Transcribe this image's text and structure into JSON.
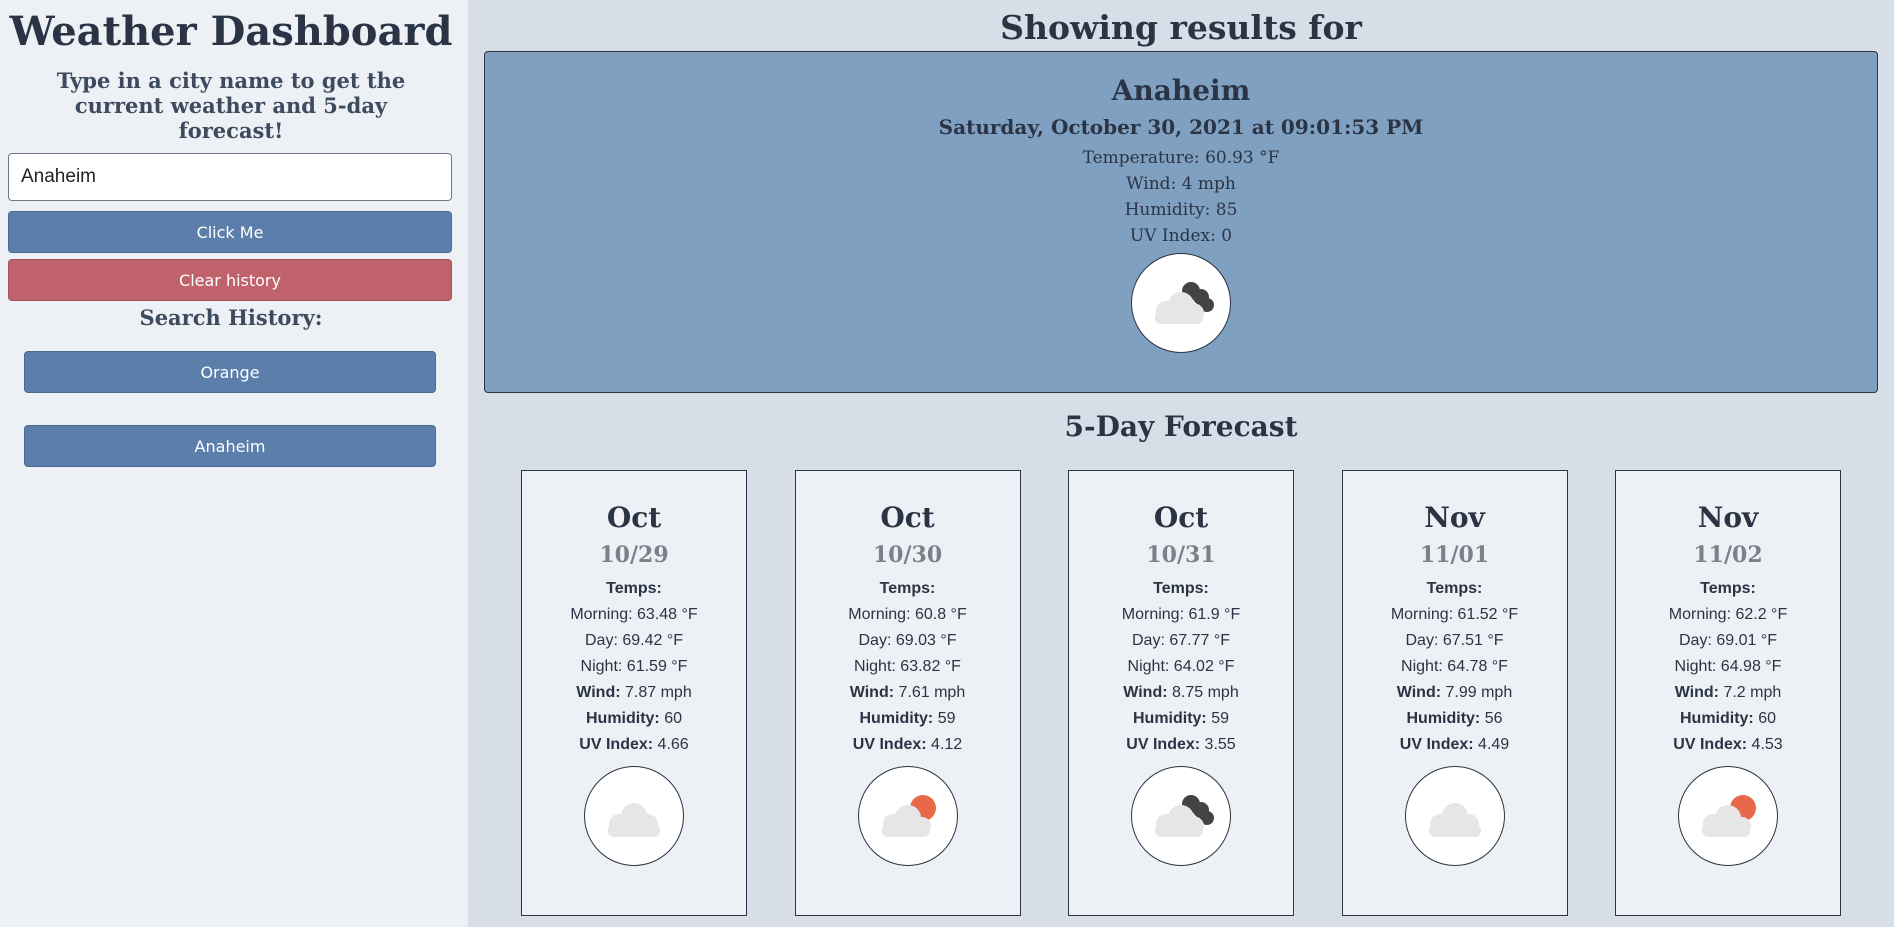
{
  "sidebar": {
    "title": "Weather Dashboard",
    "subtitle": "Type in a city name to get the current weather and 5-day forecast!",
    "search_value": "Anaheim",
    "submit_label": "Click Me",
    "clear_label": "Clear history",
    "history_title": "Search History:",
    "history": [
      {
        "label": "Orange"
      },
      {
        "label": "Anaheim"
      }
    ]
  },
  "main": {
    "results_heading": "Showing results for",
    "current": {
      "city": "Anaheim",
      "datetime": "Saturday, October 30, 2021 at 09:01:53 PM",
      "temperature": "Temperature: 60.93 °F",
      "wind": "Wind: 4 mph",
      "humidity": "Humidity: 85",
      "uv": "UV Index: 0",
      "icon": "cloudy-night-icon"
    },
    "forecast_heading": "5-Day Forecast",
    "labels": {
      "temps": "Temps:",
      "morning": "Morning:",
      "day": "Day:",
      "night": "Night:",
      "wind": "Wind:",
      "humidity": "Humidity:",
      "uv": "UV Index:"
    },
    "forecast": [
      {
        "month": "Oct",
        "date": "10/29",
        "morning": "63.48 °F",
        "day": "69.42 °F",
        "night": "61.59 °F",
        "wind": "7.87 mph",
        "humidity": "60",
        "uv": "4.66",
        "icon": "cloud-icon"
      },
      {
        "month": "Oct",
        "date": "10/30",
        "morning": "60.8 °F",
        "day": "69.03 °F",
        "night": "63.82 °F",
        "wind": "7.61 mph",
        "humidity": "59",
        "uv": "4.12",
        "icon": "partly-cloudy-day-icon"
      },
      {
        "month": "Oct",
        "date": "10/31",
        "morning": "61.9 °F",
        "day": "67.77 °F",
        "night": "64.02 °F",
        "wind": "8.75 mph",
        "humidity": "59",
        "uv": "3.55",
        "icon": "cloudy-night-icon"
      },
      {
        "month": "Nov",
        "date": "11/01",
        "morning": "61.52 °F",
        "day": "67.51 °F",
        "night": "64.78 °F",
        "wind": "7.99 mph",
        "humidity": "56",
        "uv": "4.49",
        "icon": "cloud-icon"
      },
      {
        "month": "Nov",
        "date": "11/02",
        "morning": "62.2 °F",
        "day": "69.01 °F",
        "night": "64.98 °F",
        "wind": "7.2 mph",
        "humidity": "60",
        "uv": "4.53",
        "icon": "partly-cloudy-day-icon"
      }
    ]
  },
  "colors": {
    "primary_button": "#5b7eaa",
    "danger_button": "#c0626b",
    "current_card_bg": "#7fa0c0",
    "sun": "#e8694a",
    "moon_cloud": "#444444"
  }
}
